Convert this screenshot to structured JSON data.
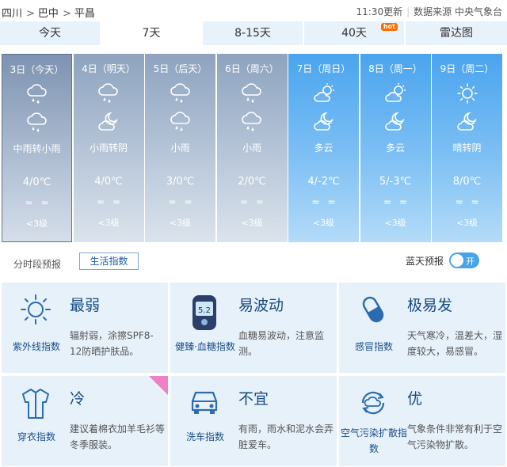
{
  "breadcrumb": {
    "province": "四川",
    "city": "巴中",
    "county": "平昌"
  },
  "meta": {
    "update": "11:30更新",
    "source": "数据来源 中央气象台"
  },
  "tabs": [
    {
      "label": "今天"
    },
    {
      "label": "7天"
    },
    {
      "label": "8-15天"
    },
    {
      "label": "40天",
      "badge": "hot"
    },
    {
      "label": "雷达图"
    }
  ],
  "active_tab": "7天",
  "days": [
    {
      "date": "3日（今天）",
      "icon1": "rain-cloud-icon",
      "icon2": "rain-cloud-icon",
      "cond": "中雨转小雨",
      "temp": "4/0℃",
      "wind": "≈≈",
      "level": "<3级"
    },
    {
      "date": "4日（明天）",
      "icon1": "rain-cloud-icon",
      "icon2": "moon-cloud-icon",
      "cond": "小雨转阴",
      "temp": "4/0℃",
      "wind": "≈≈",
      "level": "<3级"
    },
    {
      "date": "5日（后天）",
      "icon1": "rain-cloud-icon",
      "icon2": "rain-cloud-icon",
      "cond": "小雨",
      "temp": "3/0℃",
      "wind": "≈≈",
      "level": "<3级"
    },
    {
      "date": "6日（周六）",
      "icon1": "rain-cloud-icon",
      "icon2": "rain-cloud-icon",
      "cond": "小雨",
      "temp": "2/0℃",
      "wind": "≈≈",
      "level": "<3级"
    },
    {
      "date": "7日（周日）",
      "icon1": "sun-cloud-icon",
      "icon2": "moon-cloud-icon",
      "cond": "多云",
      "temp": "4/-2℃",
      "wind": "≈≈",
      "level": "<3级"
    },
    {
      "date": "8日（周一）",
      "icon1": "sun-cloud-icon",
      "icon2": "moon-cloud-icon",
      "cond": "多云",
      "temp": "5/-3℃",
      "wind": "≈≈",
      "level": "<3级"
    },
    {
      "date": "9日（周二）",
      "icon1": "sun-icon",
      "icon2": "moon-cloud-icon",
      "cond": "晴转阴",
      "temp": "8/0℃",
      "wind": "≈≈",
      "level": "<3级"
    }
  ],
  "subbar": {
    "hourly": "分时段预报",
    "life": "生活指数",
    "bluesky": "蓝天预报",
    "toggle": "开"
  },
  "indices": [
    {
      "name": "紫外线指数",
      "value": "最弱",
      "desc": "辐射弱，涂擦SPF8-12防晒护肤品。",
      "icon": "sun-icon"
    },
    {
      "name": "健臻·血糖指数",
      "value": "易波动",
      "desc": "血糖易波动，注意监测。",
      "icon": "glucose-meter-icon"
    },
    {
      "name": "感冒指数",
      "value": "极易发",
      "desc": "天气寒冷，温差大，湿度较大，易感冒。",
      "icon": "pill-icon"
    },
    {
      "name": "穿衣指数",
      "value": "冷",
      "desc": "建议着棉衣加羊毛衫等冬季服装。",
      "icon": "coat-icon"
    },
    {
      "name": "洗车指数",
      "value": "不宜",
      "desc": "有雨，雨水和泥水会弄脏爱车。",
      "icon": "car-icon"
    },
    {
      "name": "空气污染扩散指数",
      "value": "优",
      "desc": "气象条件非常有利于空气污染物扩散。",
      "icon": "air-cycle-icon"
    }
  ],
  "colors": {
    "accent": "#1d5ea8",
    "sunny_col": "#4aa4ee",
    "rain_col": "#8ea3bf",
    "card_bg": "#e7f1fa",
    "hot": "#ff6d00",
    "toggle": "#4aa3e6"
  }
}
